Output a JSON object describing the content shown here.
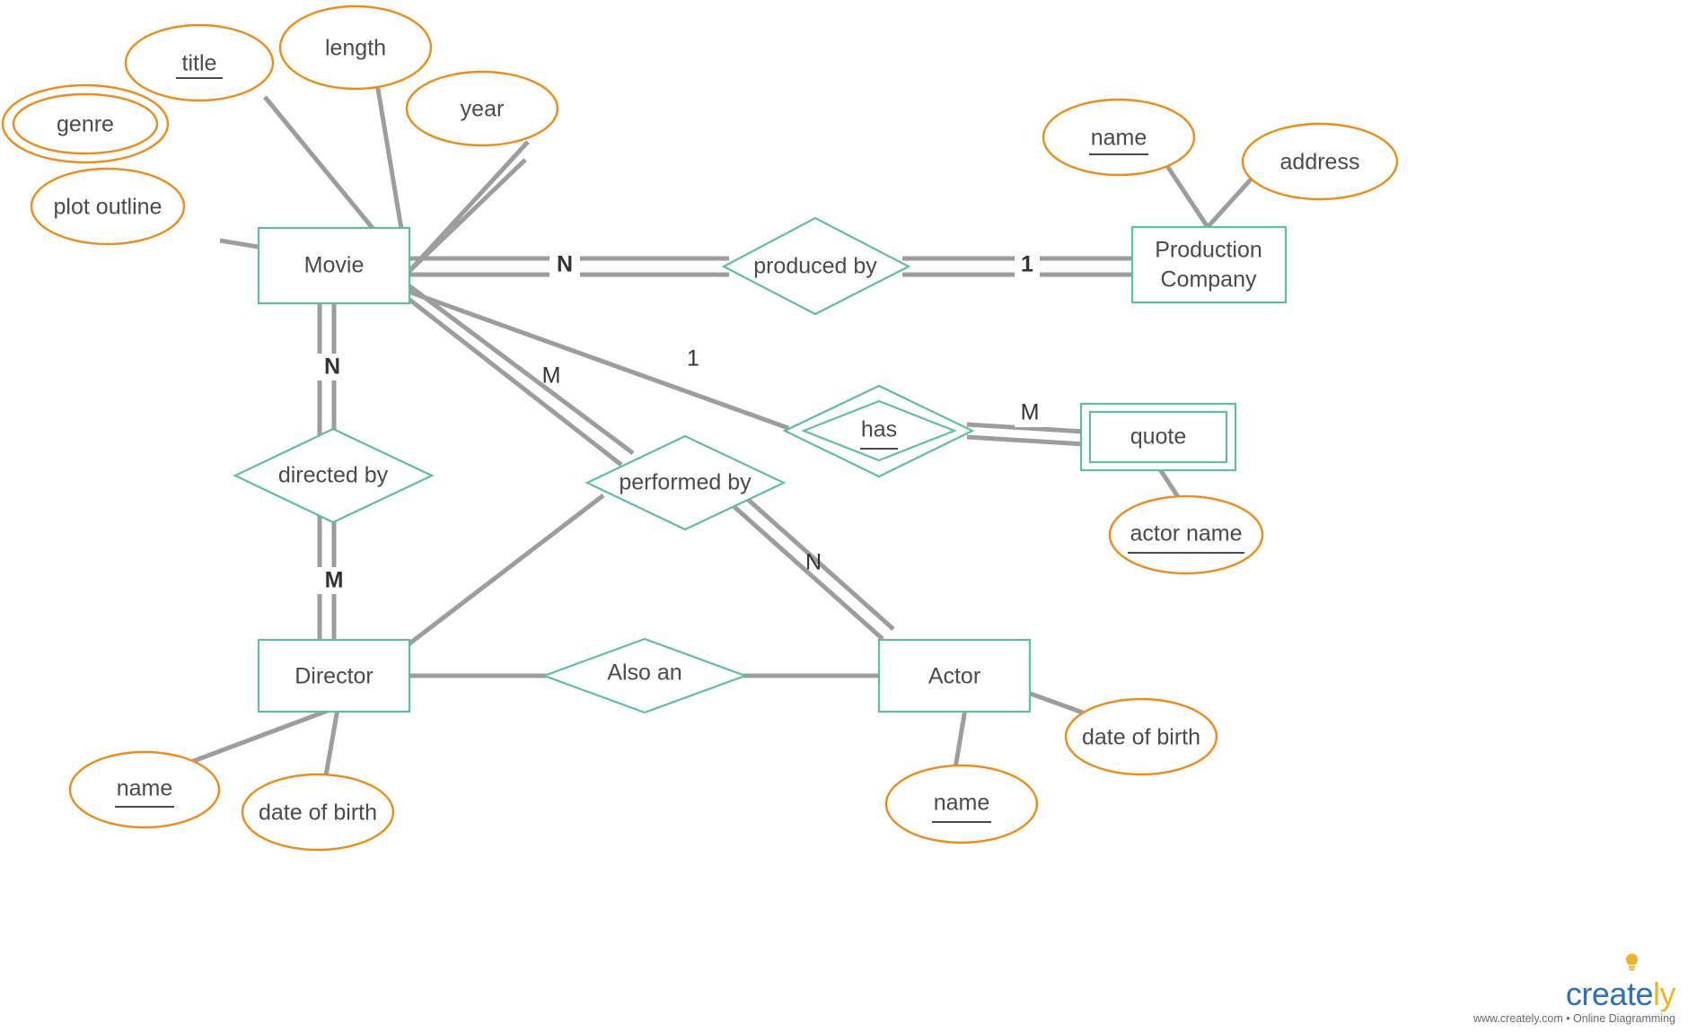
{
  "diagram": {
    "title": "Movie Database ER Diagram",
    "type": "entity-relationship-diagram",
    "colors": {
      "entity_stroke": "#5fbf9c",
      "relationship_stroke": "#5fbf9c",
      "attribute_stroke": "#ec8c1c",
      "edge": "#9d9d9d",
      "text": "#4a4a4a",
      "background": "#ffffff"
    },
    "entities": [
      {
        "id": "movie",
        "label": "Movie",
        "weak": false
      },
      {
        "id": "production_company",
        "label_line1": "Production",
        "label_line2": "Company",
        "label": "Production Company",
        "weak": false
      },
      {
        "id": "quote",
        "label": "quote",
        "weak": true
      },
      {
        "id": "director",
        "label": "Director",
        "weak": false
      },
      {
        "id": "actor",
        "label": "Actor",
        "weak": false
      }
    ],
    "relationships": [
      {
        "id": "produced_by",
        "label": "produced by",
        "identifying": false
      },
      {
        "id": "has",
        "label": "has",
        "identifying": true,
        "underlined": true
      },
      {
        "id": "directed_by",
        "label": "directed by",
        "identifying": false
      },
      {
        "id": "performed_by",
        "label": "performed by",
        "identifying": false
      },
      {
        "id": "also_an",
        "label": "Also an",
        "identifying": false
      }
    ],
    "attributes": [
      {
        "id": "movie_genre",
        "label": "genre",
        "multivalued": true,
        "key": false,
        "owner": "movie"
      },
      {
        "id": "movie_title",
        "label": "title",
        "multivalued": false,
        "key": true,
        "owner": "movie"
      },
      {
        "id": "movie_length",
        "label": "length",
        "multivalued": false,
        "key": false,
        "owner": "movie"
      },
      {
        "id": "movie_year",
        "label": "year",
        "multivalued": false,
        "key": false,
        "owner": "movie"
      },
      {
        "id": "movie_plot_outline",
        "label": "plot outline",
        "multivalued": false,
        "key": false,
        "owner": "movie"
      },
      {
        "id": "pc_name",
        "label": "name",
        "multivalued": false,
        "key": true,
        "owner": "production_company"
      },
      {
        "id": "pc_address",
        "label": "address",
        "multivalued": false,
        "key": false,
        "owner": "production_company"
      },
      {
        "id": "quote_actor_name",
        "label": "actor name",
        "multivalued": false,
        "key": true,
        "owner": "quote"
      },
      {
        "id": "director_name",
        "label": "name",
        "multivalued": false,
        "key": true,
        "owner": "director"
      },
      {
        "id": "director_dob",
        "label": "date of birth",
        "multivalued": false,
        "key": false,
        "owner": "director"
      },
      {
        "id": "actor_name",
        "label": "name",
        "multivalued": false,
        "key": true,
        "owner": "actor"
      },
      {
        "id": "actor_dob",
        "label": "date of birth",
        "multivalued": false,
        "key": false,
        "owner": "actor"
      }
    ],
    "cardinalities": [
      {
        "id": "movie_produced_by",
        "label": "N",
        "bold": true,
        "from": "movie",
        "to": "produced_by"
      },
      {
        "id": "produced_by_pc",
        "label": "1",
        "bold": true,
        "from": "produced_by",
        "to": "production_company"
      },
      {
        "id": "movie_directed_by",
        "label": "N",
        "bold": true,
        "from": "movie",
        "to": "directed_by"
      },
      {
        "id": "directed_by_director",
        "label": "M",
        "bold": true,
        "from": "directed_by",
        "to": "director"
      },
      {
        "id": "movie_performed_by",
        "label": "M",
        "bold": false,
        "from": "movie",
        "to": "performed_by"
      },
      {
        "id": "performed_by_actor",
        "label": "N",
        "bold": false,
        "from": "performed_by",
        "to": "actor"
      },
      {
        "id": "movie_has",
        "label": "1",
        "bold": false,
        "from": "movie",
        "to": "has"
      },
      {
        "id": "has_quote",
        "label": "M",
        "bold": false,
        "from": "has",
        "to": "quote"
      }
    ],
    "watermark": {
      "brand_part1": "creat",
      "brand_part2": "e",
      "brand_part3": "ly",
      "tagline": "www.creately.com • Online Diagramming"
    }
  }
}
